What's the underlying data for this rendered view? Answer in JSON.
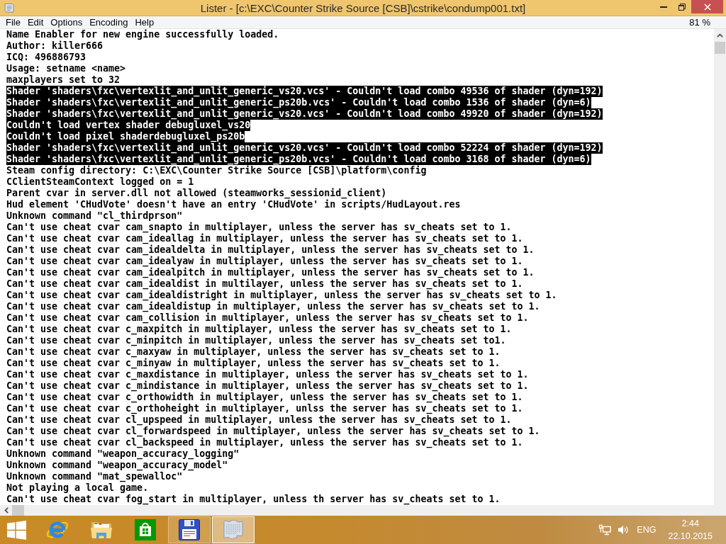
{
  "window": {
    "title": "Lister - [c:\\EXC\\Counter Strike Source [CSB]\\cstrike\\condump001.txt]"
  },
  "menu": [
    {
      "label": "File"
    },
    {
      "label": "Edit"
    },
    {
      "label": "Options"
    },
    {
      "label": "Encoding"
    },
    {
      "label": "Help"
    }
  ],
  "zoom_level": "81 %",
  "lines": [
    {
      "text": "Name Enabler for new engine successfully loaded.",
      "selected": false
    },
    {
      "text": "Author: killer666",
      "selected": false
    },
    {
      "text": "ICQ: 496886793",
      "selected": false
    },
    {
      "text": "Usage: setname <name>",
      "selected": false
    },
    {
      "text": "maxplayers set to 32",
      "selected": false
    },
    {
      "text": "Shader 'shaders\\fxc\\vertexlit_and_unlit_generic_vs20.vcs' - Couldn't load combo 49536 of shader (dyn=192)",
      "selected": true
    },
    {
      "text": "Shader 'shaders\\fxc\\vertexlit_and_unlit_generic_ps20b.vcs' - Couldn't load combo 1536 of shader (dyn=6)",
      "selected": true
    },
    {
      "text": "Shader 'shaders\\fxc\\vertexlit_and_unlit_generic_vs20.vcs' - Couldn't load combo 49920 of shader (dyn=192)",
      "selected": true
    },
    {
      "text": "Couldn't load vertex shader debugluxel_vs20",
      "selected": true
    },
    {
      "text": "Couldn't load pixel shaderdebugluxel_ps20b",
      "selected": true
    },
    {
      "text": "Shader 'shaders\\fxc\\vertexlit_and_unlit_generic_vs20.vcs' - Couldn't load combo 52224 of shader (dyn=192)",
      "selected": true
    },
    {
      "text": "Shader 'shaders\\fxc\\vertexlit_and_unlit_generic_ps20b.vcs' - Couldn't load combo 3168 of shader (dyn=6)",
      "selected": true
    },
    {
      "text": "Steam config directory: C:\\EXC\\Counter Strike Source [CSB]\\platform\\config",
      "selected": false
    },
    {
      "text": "CClientSteamContext logged on = 1",
      "selected": false
    },
    {
      "text": "Parent cvar in server.dll not allowed (steamworks_sessionid_client)",
      "selected": false
    },
    {
      "text": "Hud element 'CHudVote' doesn't have an entry 'CHudVote' in scripts/HudLayout.res",
      "selected": false
    },
    {
      "text": "Unknown command \"cl_thirdprson\"",
      "selected": false
    },
    {
      "text": "Can't use cheat cvar cam_snapto in multiplayer, unless the server has sv_cheats set to 1.",
      "selected": false
    },
    {
      "text": "Can't use cheat cvar cam_ideallag in multiplayer, unless the server has sv_cheats set to 1.",
      "selected": false
    },
    {
      "text": "Can't use cheat cvar cam_idealdelta in multiplayer, unless the server has sv_cheats set to 1.",
      "selected": false
    },
    {
      "text": "Can't use cheat cvar cam_idealyaw in multiplayer, unless the server has sv_cheats set to 1.",
      "selected": false
    },
    {
      "text": "Can't use cheat cvar cam_idealpitch in multiplayer, unless the server has sv_cheats set to 1.",
      "selected": false
    },
    {
      "text": "Can't use cheat cvar cam_idealdist in multilayer, unless the server has sv_cheats set to 1.",
      "selected": false
    },
    {
      "text": "Can't use cheat cvar cam_idealdistright in multiplayer, unless the server has sv_cheats set to 1.",
      "selected": false
    },
    {
      "text": "Can't use cheat cvar cam_idealdistup in multiplayer, unless the server has sv_cheats set to 1.",
      "selected": false
    },
    {
      "text": "Can't use cheat cvar cam_collision in multiplayer, unless the server has sv_cheats set to 1.",
      "selected": false
    },
    {
      "text": "Can't use cheat cvar c_maxpitch in multiplayer, unless the server has sv_cheats set to 1.",
      "selected": false
    },
    {
      "text": "Can't use cheat cvar c_minpitch in multiplayer, unless the server has sv_cheats set to1.",
      "selected": false
    },
    {
      "text": "Can't use cheat cvar c_maxyaw in multiplayer, unless the server has sv_cheats set to 1.",
      "selected": false
    },
    {
      "text": "Can't use cheat cvar c_minyaw in multiplayer, unless the server has sv_cheats set to 1.",
      "selected": false
    },
    {
      "text": "Can't use cheat cvar c_maxdistance in multiplayer, unless the server has sv_cheats set to 1.",
      "selected": false
    },
    {
      "text": "Can't use cheat cvar c_mindistance in multiplayer, unless the server has sv_cheats set to 1.",
      "selected": false
    },
    {
      "text": "Can't use cheat cvar c_orthowidth in multiplayer, unless the server has sv_cheats set to 1.",
      "selected": false
    },
    {
      "text": "Can't use cheat cvar c_orthoheight in multiplayer, unlss the server has sv_cheats set to 1.",
      "selected": false
    },
    {
      "text": "Can't use cheat cvar cl_upspeed in multiplayer, unless the server has sv_cheats set to 1.",
      "selected": false
    },
    {
      "text": "Can't use cheat cvar cl_forwardspeed in multiplayer, unless the server has sv_cheats set to 1.",
      "selected": false
    },
    {
      "text": "Can't use cheat cvar cl_backspeed in multiplayer, unless the server has sv_cheats set to 1.",
      "selected": false
    },
    {
      "text": "Unknown command \"weapon_accuracy_logging\"",
      "selected": false
    },
    {
      "text": "Unknown command \"weapon_accuracy_model\"",
      "selected": false
    },
    {
      "text": "Unknown command \"mat_spewalloc\"",
      "selected": false
    },
    {
      "text": "Not playing a local game.",
      "selected": false
    },
    {
      "text": "Can't use cheat cvar fog_start in multiplayer, unless th server has sv_cheats set to 1.",
      "selected": false
    }
  ],
  "taskbar": {
    "apps": [
      {
        "kind": "start",
        "running": false,
        "selected": false
      },
      {
        "kind": "browser",
        "running": false,
        "selected": false
      },
      {
        "kind": "folder",
        "running": false,
        "selected": false
      },
      {
        "kind": "store",
        "running": false,
        "selected": false
      },
      {
        "kind": "floppy",
        "running": true,
        "selected": false
      },
      {
        "kind": "document",
        "running": true,
        "selected": true
      }
    ],
    "language": "ENG",
    "time": "2:44",
    "date": "22.10.2015"
  }
}
